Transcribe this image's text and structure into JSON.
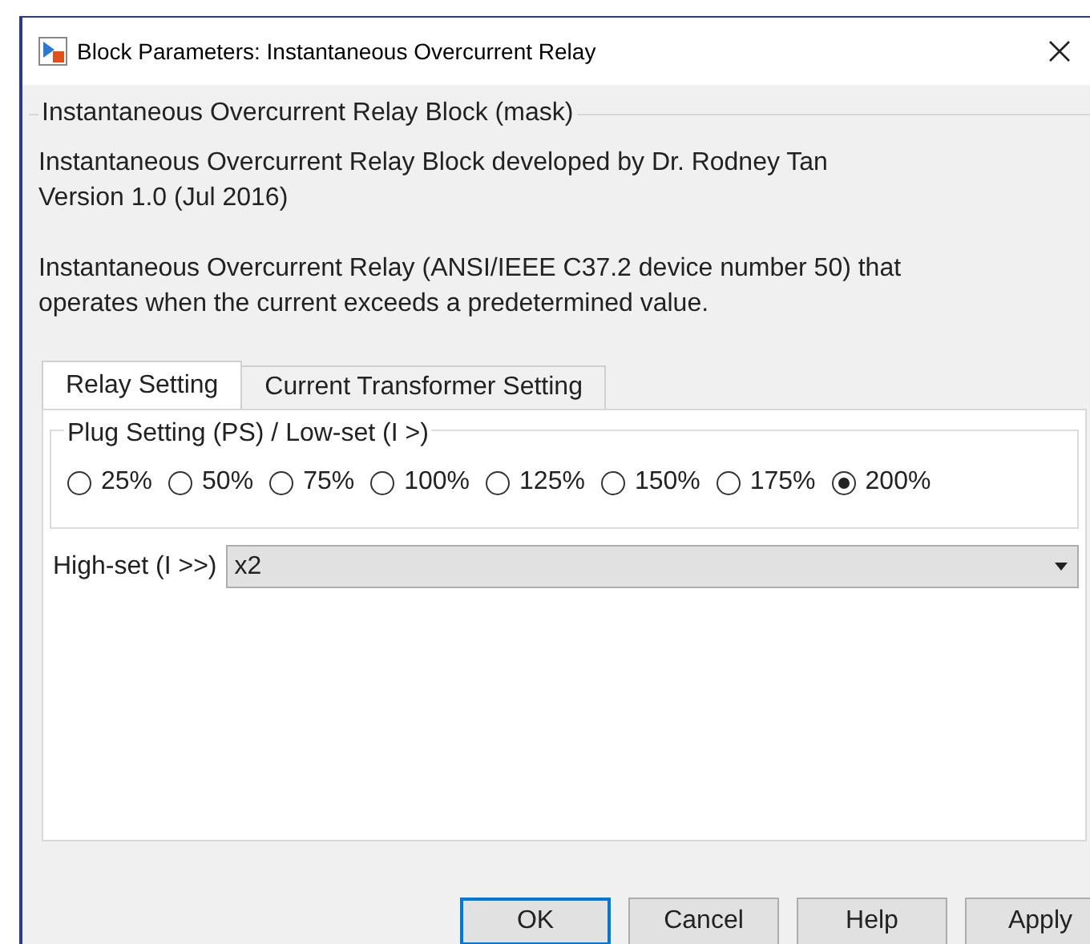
{
  "window": {
    "title": "Block Parameters: Instantaneous Overcurrent Relay"
  },
  "mask": {
    "title": "Instantaneous Overcurrent Relay Block (mask)",
    "paragraphs": [
      [
        "Instantaneous Overcurrent Relay Block developed by Dr. Rodney Tan",
        "Version 1.0 (Jul 2016)"
      ],
      [
        "Instantaneous Overcurrent Relay (ANSI/IEEE C37.2 device number 50) that",
        "operates when the current exceeds a predetermined value."
      ]
    ]
  },
  "tabs": [
    {
      "label": "Relay Setting",
      "selected": true
    },
    {
      "label": "Current Transformer Setting",
      "selected": false
    }
  ],
  "plug_setting": {
    "title": "Plug Setting (PS) / Low-set (I >)",
    "options": [
      {
        "label": "25%",
        "selected": false
      },
      {
        "label": "50%",
        "selected": false
      },
      {
        "label": "75%",
        "selected": false
      },
      {
        "label": "100%",
        "selected": false
      },
      {
        "label": "125%",
        "selected": false
      },
      {
        "label": "150%",
        "selected": false
      },
      {
        "label": "175%",
        "selected": false
      },
      {
        "label": "200%",
        "selected": true
      }
    ]
  },
  "high_set": {
    "label": "High-set (I >>)",
    "value": "x2"
  },
  "buttons": [
    {
      "label": "OK",
      "default": true
    },
    {
      "label": "Cancel",
      "default": false
    },
    {
      "label": "Help",
      "default": false
    },
    {
      "label": "Apply",
      "default": false
    }
  ]
}
